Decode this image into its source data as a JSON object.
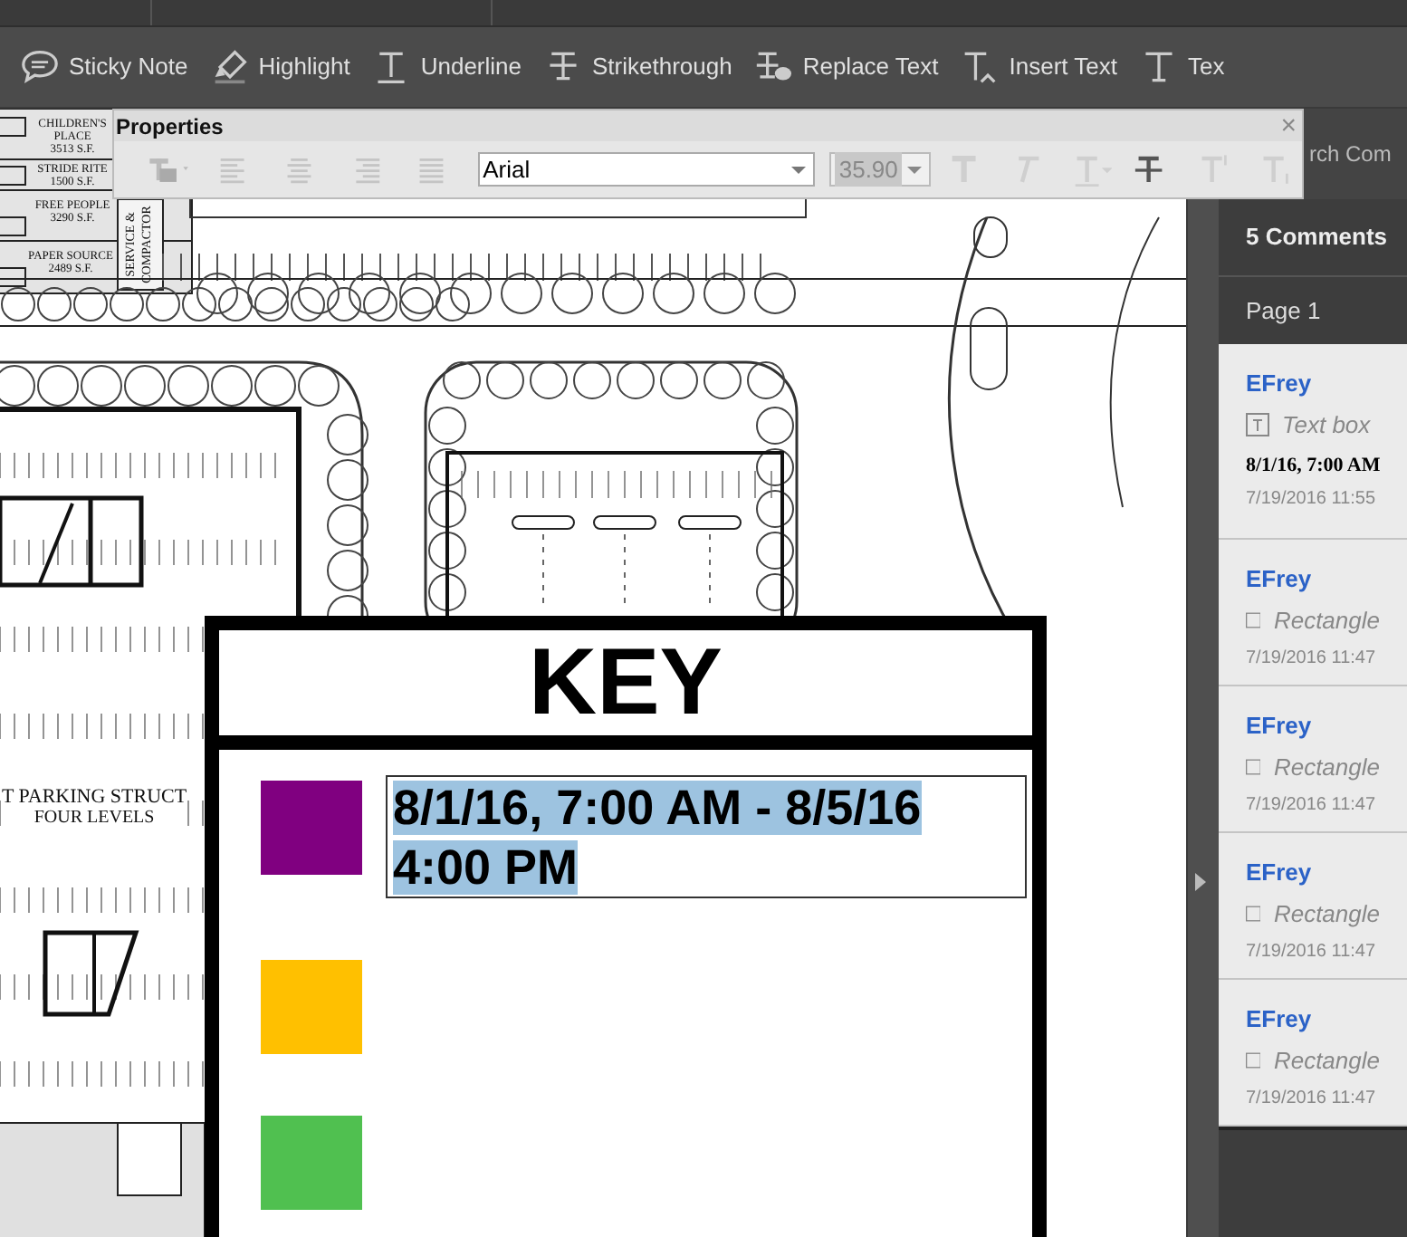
{
  "tools": [
    {
      "kind": "note",
      "label": "Sticky Note"
    },
    {
      "kind": "highlight",
      "label": "Highlight"
    },
    {
      "kind": "underline",
      "label": "Underline"
    },
    {
      "kind": "strike",
      "label": "Strikethrough"
    },
    {
      "kind": "replace",
      "label": "Replace Text"
    },
    {
      "kind": "insert",
      "label": "Insert Text"
    },
    {
      "kind": "text",
      "label": "Tex"
    }
  ],
  "properties": {
    "title": "Properties",
    "close": "×",
    "font": "Arial",
    "size": "35.90",
    "size_disabled": true,
    "align_buttons": [
      {
        "kind": "left",
        "disabled": true
      },
      {
        "kind": "center",
        "disabled": true
      },
      {
        "kind": "right",
        "disabled": true
      },
      {
        "kind": "justify",
        "disabled": true
      }
    ],
    "format_buttons": [
      {
        "kind": "bold",
        "disabled": true
      },
      {
        "kind": "italic",
        "disabled": true
      },
      {
        "kind": "underline",
        "disabled": true
      },
      {
        "kind": "strike",
        "disabled": false
      },
      {
        "kind": "super",
        "disabled": true
      },
      {
        "kind": "sub",
        "disabled": true
      }
    ]
  },
  "document": {
    "plan_labels": [
      {
        "kind": "store",
        "lines": [
          "CHILDREN'S",
          "PLACE",
          "3513 S.F."
        ]
      },
      {
        "kind": "store",
        "lines": [
          "STRIDE RITE",
          "1500 S.F."
        ]
      },
      {
        "kind": "store",
        "lines": [
          "FREE PEOPLE",
          "3290 S.F."
        ]
      },
      {
        "kind": "store",
        "lines": [
          "PAPER SOURCE",
          "2489 S.F."
        ]
      },
      {
        "kind": "service",
        "lines": [
          "SERVICE &",
          "COMPACTOR"
        ]
      },
      {
        "kind": "parking",
        "lines": [
          "T PARKING STRUCT",
          "FOUR LEVELS"
        ]
      }
    ],
    "key": {
      "title": "KEY",
      "entries": [
        {
          "color": "#800080",
          "text": "8/1/16, 7:00 AM - 8/5/16 4:00 PM",
          "selected": true
        },
        {
          "color": "#ffc000"
        },
        {
          "color": "#50c050"
        }
      ]
    }
  },
  "comments_panel": {
    "search_text": "rch Com",
    "count": "5 Comments",
    "page": "Page 1",
    "comments": [
      {
        "author": "EFrey",
        "kind": "textbox",
        "type": "Text box",
        "content": "8/1/16, 7:00 AM",
        "date": "7/19/2016  11:55"
      },
      {
        "author": "EFrey",
        "kind": "rectangle",
        "type": "Rectangle",
        "date": "7/19/2016  11:47"
      },
      {
        "author": "EFrey",
        "kind": "rectangle",
        "type": "Rectangle",
        "date": "7/19/2016  11:47"
      },
      {
        "author": "EFrey",
        "kind": "rectangle",
        "type": "Rectangle",
        "date": "7/19/2016  11:47"
      },
      {
        "author": "EFrey",
        "kind": "rectangle",
        "type": "Rectangle",
        "date": "7/19/2016  11:47"
      }
    ]
  }
}
